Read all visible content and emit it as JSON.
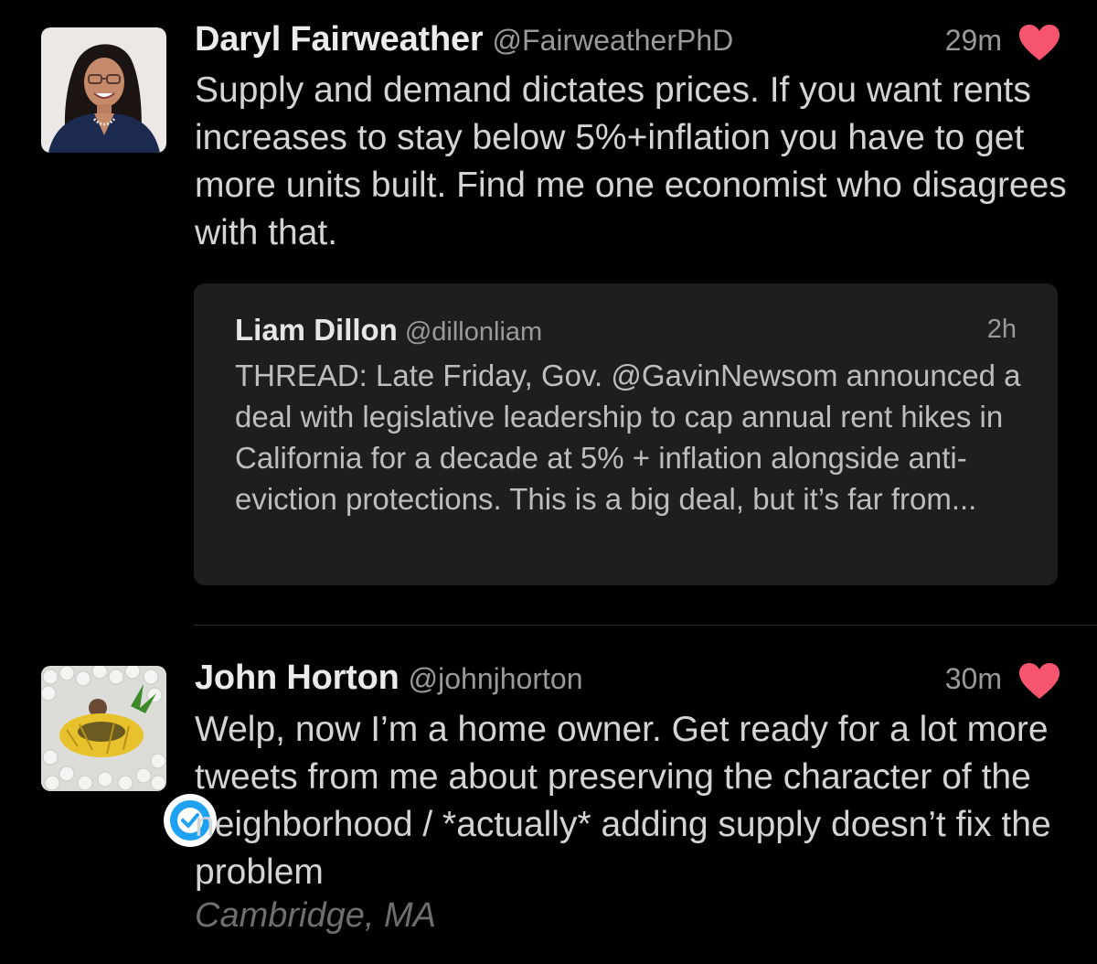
{
  "tweets": [
    {
      "name": "Daryl Fairweather",
      "handle": "@FairweatherPhD",
      "time": "29m",
      "liked": true,
      "text": "Supply and demand dictates prices. If you want rents increases to stay below 5%+inflation you have to get more units built. Find me one economist who disagrees with that.",
      "avatar_icon": "profile-photo-woman",
      "quote": {
        "name": "Liam Dillon",
        "handle": "@dillonliam",
        "time": "2h",
        "text": "THREAD: Late Friday, Gov. @GavinNewsom announced a deal with legislative leadership to cap annual rent hikes in California for a decade at 5% + inflation alongside anti-eviction protections. This is a big deal, but it’s far from..."
      }
    },
    {
      "name": "John Horton",
      "handle": "@johnjhorton",
      "time": "30m",
      "liked": true,
      "verified": true,
      "text": "Welp, now I’m a home owner. Get ready for a lot more tweets from me about preserving the character of the neighborhood / *actually* adding supply doesn’t fix the problem",
      "location": "Cambridge, MA",
      "avatar_icon": "profile-photo-pineapple-float"
    }
  ],
  "colors": {
    "background": "#000000",
    "heart": "#f7546f",
    "verified": "#1da1f2",
    "quote_background": "#1e1e1e"
  }
}
